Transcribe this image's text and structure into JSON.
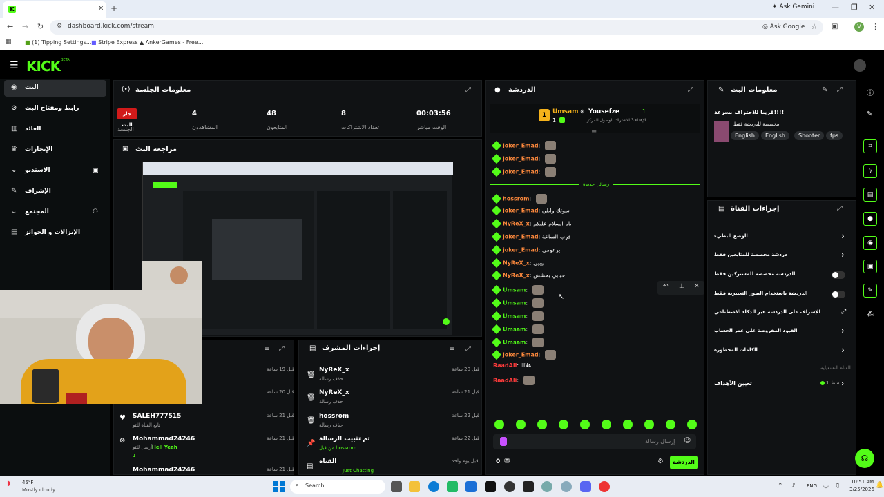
{
  "browser": {
    "tab_title": "Stream - Kick Dashboard",
    "url": "dashboard.kick.com/stream",
    "ask_gemini": "Ask Gemini",
    "ask_google": "Ask Google",
    "profile_initial": "V",
    "bookmarks": [
      "(1) Tipping Settings...",
      "Stripe Express",
      "AnkerGames - Free..."
    ]
  },
  "kick": {
    "logo": "KICK",
    "logo_beta": "BETA",
    "sidebar": [
      {
        "label": "البث",
        "icon": "broadcast-icon",
        "active": true
      },
      {
        "label": "رابط ومفتاح البث",
        "icon": "link-icon"
      },
      {
        "label": "العائد",
        "icon": "chart-icon"
      },
      {
        "label": "الإنجازات",
        "icon": "trophy-icon"
      },
      {
        "label": "الاستديو",
        "icon": "studio-icon"
      },
      {
        "label": "الإشراف",
        "icon": "wrench-icon"
      },
      {
        "label": "المجتمع",
        "icon": "community-icon"
      },
      {
        "label": "الإنزالات و الجوائز",
        "icon": "drops-icon"
      }
    ],
    "session": {
      "title": "معلومات الجلسة",
      "live_badge": "جار البث",
      "live_label": "الجلسة",
      "stats": [
        {
          "value": "4",
          "label": "المشاهدون"
        },
        {
          "value": "48",
          "label": "المتابعون"
        },
        {
          "value": "8",
          "label": "تعداد الاشتراكات"
        },
        {
          "value": "00:03:56",
          "label": "الوقت مباشر"
        }
      ]
    },
    "preview_title": "مراجعة البث",
    "activity": [
      {
        "user": "",
        "action": "",
        "time": "قبل 19 ساعة"
      },
      {
        "user": "",
        "action": "",
        "time": "قبل 20 ساعة"
      },
      {
        "user": "SALEH777515",
        "action": "تابع القناة للتو",
        "time": "قبل 21 ساعة"
      },
      {
        "user": "Mohammad24246",
        "action": "أرسل للتو",
        "extra": "Hell Yeah",
        "count": "1",
        "time": "قبل 21 ساعة"
      },
      {
        "user": "Mohammad24246",
        "action": "",
        "time": "قبل 21 ساعة"
      }
    ],
    "mod_actions": {
      "title": "إجراءات المشرف",
      "items": [
        {
          "user": "NyReX_x",
          "action": "حذف رسالة",
          "time": "قبل 20 ساعة"
        },
        {
          "user": "NyReX_x",
          "action": "حذف رسالة",
          "time": "قبل 21 ساعة"
        },
        {
          "user": "hossrom",
          "action": "حذف رسالة",
          "time": "قبل 22 ساعة"
        },
        {
          "user": "تم تثبيت الرسالة",
          "action": "من قبل hossrom",
          "time": "قبل 22 ساعة"
        },
        {
          "user": "القناة",
          "action": "Just Chatting",
          "time": "قبل يوم واحد"
        }
      ]
    },
    "chat": {
      "title": "الدردشة",
      "pinned": [
        {
          "name": "Umsam",
          "count": "1"
        },
        {
          "name": "Yousefze",
          "count": "1",
          "sub": "الإهداء 3 الاشتراك للوصول للمركز"
        }
      ],
      "new_messages": "رسائل جديدة",
      "messages": [
        {
          "user": "joker_Emad",
          "text": "",
          "color": "orange",
          "emote": true
        },
        {
          "user": "joker_Emad",
          "text": "",
          "color": "orange",
          "emote": true
        },
        {
          "user": "joker_Emad",
          "text": "",
          "color": "orange",
          "emote": true
        },
        {
          "user": "hossrom",
          "text": "",
          "color": "orange",
          "emote": true
        },
        {
          "user": "joker_Emad",
          "text": "سوتك وابلي",
          "color": "orange"
        },
        {
          "user": "NyReX_x",
          "text": "يابا السلام عليكم",
          "color": "orange"
        },
        {
          "user": "joker_Emad",
          "text": "قرب الساعة",
          "color": "orange"
        },
        {
          "user": "joker_Emad",
          "text": "برعومي",
          "color": "orange"
        },
        {
          "user": "NyReX_x",
          "text": "بيبيي",
          "color": "orange"
        },
        {
          "user": "NyReX_x",
          "text": "حبابي بحشش",
          "color": "orange"
        },
        {
          "user": "Umsam",
          "text": "",
          "color": "green",
          "emote": true
        },
        {
          "user": "Umsam",
          "text": "",
          "color": "green",
          "emote": true
        },
        {
          "user": "Umsam",
          "text": "",
          "color": "green",
          "emote": true
        },
        {
          "user": "Umsam",
          "text": "",
          "color": "green",
          "emote": true
        },
        {
          "user": "Umsam",
          "text": "",
          "color": "green",
          "emote": true
        },
        {
          "user": "joker_Emad",
          "text": "",
          "color": "orange",
          "emote": true
        },
        {
          "user": "RaadAli",
          "text": "هلاااا",
          "color": "red"
        },
        {
          "user": "RaadAli",
          "text": "",
          "color": "red",
          "emote": true
        }
      ],
      "input_placeholder": "إرسال رسالة",
      "send_label": "الدردشة",
      "points": "0"
    },
    "stream_info": {
      "title": "معلومات البث",
      "stream_title": "قريبا للاحتراف بسرعة!!!!",
      "category": "مخصصة للدردشة فقط",
      "tags": [
        "English",
        "English",
        "Shooter",
        "fps"
      ]
    },
    "channel_actions": {
      "title": "إجراءات القناة",
      "items": [
        {
          "label": "الوضع البطيء",
          "type": "arrow"
        },
        {
          "label": "دردشة مخصصة للمتابعين فقط",
          "type": "arrow"
        },
        {
          "label": "الدردشة مخصصة للمشتركين فقط",
          "type": "toggle"
        },
        {
          "label": "الدردشة باستخدام الصور التعبيرية فقط",
          "type": "toggle"
        },
        {
          "label": "الإشراف على الدردشة عبر الذكاء الاصطناعي",
          "type": "link"
        },
        {
          "label": "القيود المفروضة على عمر الحساب",
          "type": "arrow"
        },
        {
          "label": "الكلمات المحظورة",
          "type": "arrow"
        }
      ],
      "section_label": "القناة التشغيلية",
      "goals_label": "تعيين الأهداف",
      "goals_status": "نشط 1"
    }
  },
  "taskbar": {
    "weather_temp": "45°F",
    "weather_desc": "Mostly cloudy",
    "search": "Search",
    "lang": "ENG",
    "time": "10:51 AM",
    "date": "3/25/2026"
  }
}
